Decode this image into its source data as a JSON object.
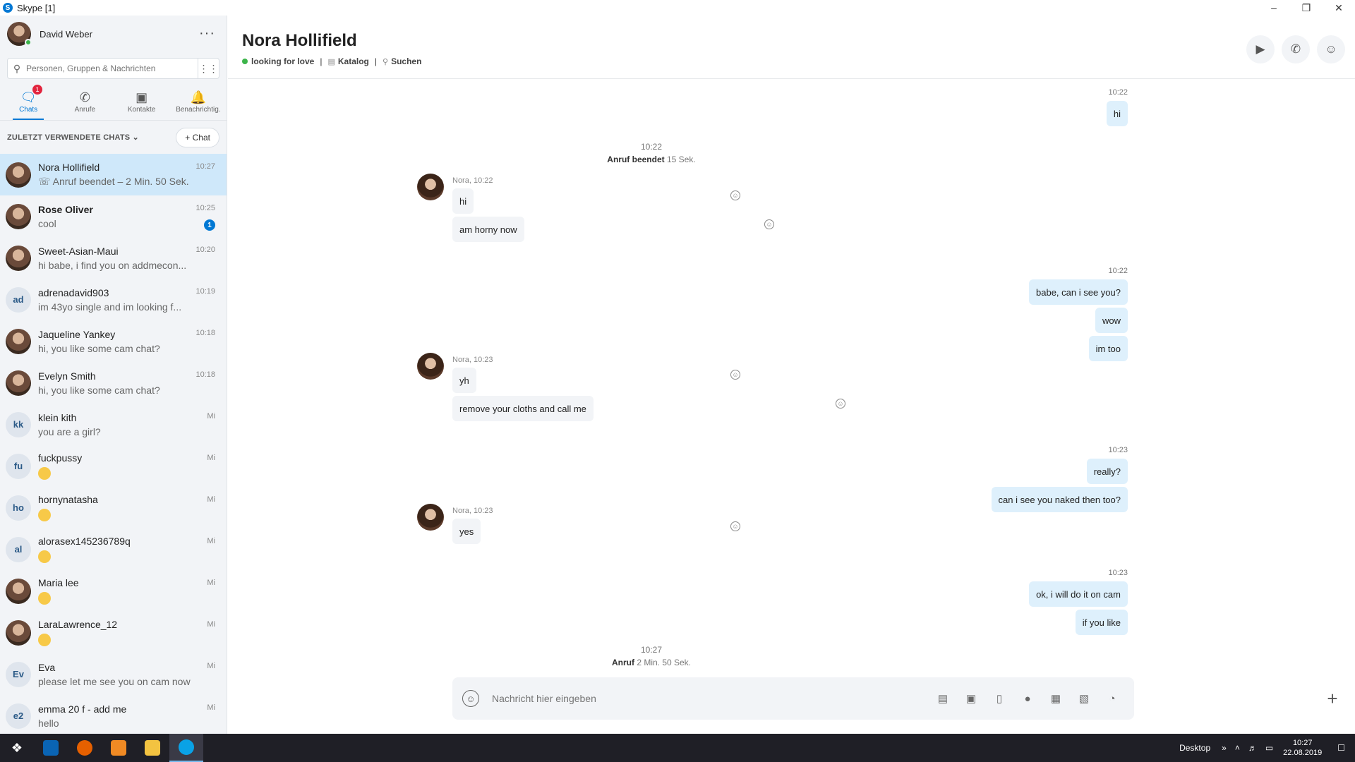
{
  "window": {
    "title": "Skype [1]",
    "app_icon": "S",
    "minimize": "–",
    "restore": "❐",
    "close": "✕"
  },
  "profile": {
    "name": "David Weber",
    "more": "···"
  },
  "search": {
    "placeholder": "Personen, Gruppen & Nachrichten"
  },
  "nav": {
    "chats": "Chats",
    "chats_badge": "1",
    "calls": "Anrufe",
    "contacts": "Kontakte",
    "notifications": "Benachrichtig."
  },
  "list_header": {
    "label": "ZULETZT VERWENDETE CHATS ⌄",
    "new_chat": "+ Chat"
  },
  "chats": [
    {
      "name": "Nora Hollifield",
      "preview": "☏ Anruf beendet – 2 Min. 50 Sek.",
      "time": "10:27",
      "active": true
    },
    {
      "name": "Rose Oliver",
      "preview": "cool",
      "time": "10:25",
      "badge": "1",
      "bold": true
    },
    {
      "name": "Sweet-Asian-Maui",
      "preview": "hi babe, i find you on addmecon...",
      "time": "10:20"
    },
    {
      "name": "adrenadavid903",
      "preview": "im 43yo single and im looking f...",
      "time": "10:19",
      "initials": "ad"
    },
    {
      "name": "Jaqueline Yankey",
      "preview": "hi, you like some cam chat?",
      "time": "10:18"
    },
    {
      "name": "Evelyn Smith",
      "preview": "hi, you like some cam chat?",
      "time": "10:18"
    },
    {
      "name": "klein kith",
      "preview": "you are a girl?",
      "time": "Mi",
      "initials": "kk"
    },
    {
      "name": "fuckpussy",
      "preview": "",
      "time": "Mi",
      "initials": "fu",
      "emoji": true
    },
    {
      "name": "hornynatasha",
      "preview": "",
      "time": "Mi",
      "initials": "ho",
      "emoji": true
    },
    {
      "name": "alorasex145236789q",
      "preview": "",
      "time": "Mi",
      "initials": "al",
      "emoji": true
    },
    {
      "name": "Maria lee",
      "preview": "",
      "time": "Mi",
      "emoji": true
    },
    {
      "name": "LaraLawrence_12",
      "preview": "",
      "time": "Mi",
      "emoji": true
    },
    {
      "name": "Eva",
      "preview": "please let me see you on cam now",
      "time": "Mi",
      "initials": "Ev"
    },
    {
      "name": "emma 20 f - add me",
      "preview": "hello",
      "time": "Mi",
      "initials": "e2"
    }
  ],
  "conversation": {
    "title": "Nora Hollifield",
    "mood": "looking for love",
    "catalog": "Katalog",
    "search": "Suchen",
    "sep": "|"
  },
  "messages": {
    "t1": "10:22",
    "m1": "hi",
    "sys1_time": "10:22",
    "sys1_label": "Anruf beendet",
    "sys1_dur": "15 Sek.",
    "nora1_meta": "Nora, 10:22",
    "n1": "hi",
    "n2": "am horny now",
    "t2": "10:22",
    "m2": "babe, can i see you?",
    "m3": "wow",
    "m4": "im too",
    "nora2_meta": "Nora, 10:23",
    "n3": "yh",
    "n4": "remove your cloths and call me",
    "t3": "10:23",
    "m5": "really?",
    "m6": "can i see you naked then too?",
    "nora3_meta": "Nora, 10:23",
    "n5": "yes",
    "t4": "10:23",
    "m7": "ok, i will do it on cam",
    "m8": "if you like",
    "sys2_time": "10:27",
    "sys2_label": "Anruf",
    "sys2_dur": "2 Min. 50 Sek."
  },
  "composer": {
    "placeholder": "Nachricht hier eingeben"
  },
  "taskbar": {
    "desktop": "Desktop",
    "chevron": "»",
    "time": "10:27",
    "date": "22.08.2019"
  }
}
